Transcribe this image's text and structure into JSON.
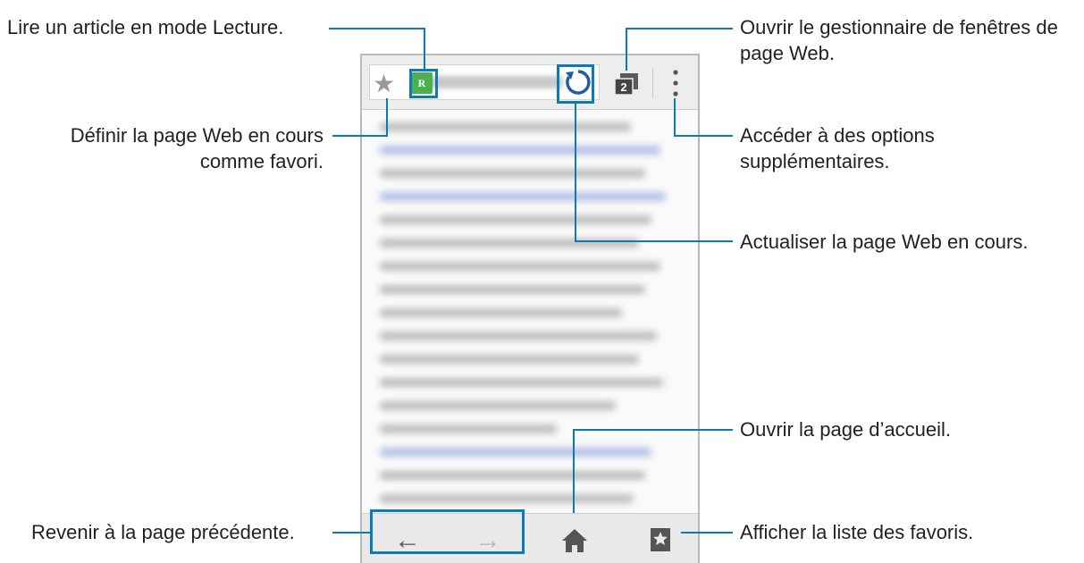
{
  "labels": {
    "reader_mode": "Lire un article en mode Lecture.",
    "window_manager": "Ouvrir le gestionnaire de fenêtres de page Web.",
    "bookmark_page": "Définir la page Web en cours comme favori.",
    "more_options": "Accéder à des options supplémentaires.",
    "refresh": "Actualiser la page Web en cours.",
    "home": "Ouvrir la page d’accueil.",
    "back": "Revenir à la page précédente.",
    "bookmarks_list": "Afficher la liste des favoris."
  },
  "browser": {
    "tab_count": "2",
    "reader_glyph": "R"
  },
  "icons": {
    "star": "star-icon",
    "reader": "reader-mode-icon",
    "refresh": "refresh-icon",
    "tabs": "window-manager-icon",
    "more": "more-options-icon",
    "back": "back-arrow-icon",
    "forward": "forward-arrow-icon",
    "home": "home-icon",
    "bookmarks": "bookmarks-icon"
  },
  "colors": {
    "callout": "#0a7bb4",
    "reader_icon": "#4caf50"
  }
}
